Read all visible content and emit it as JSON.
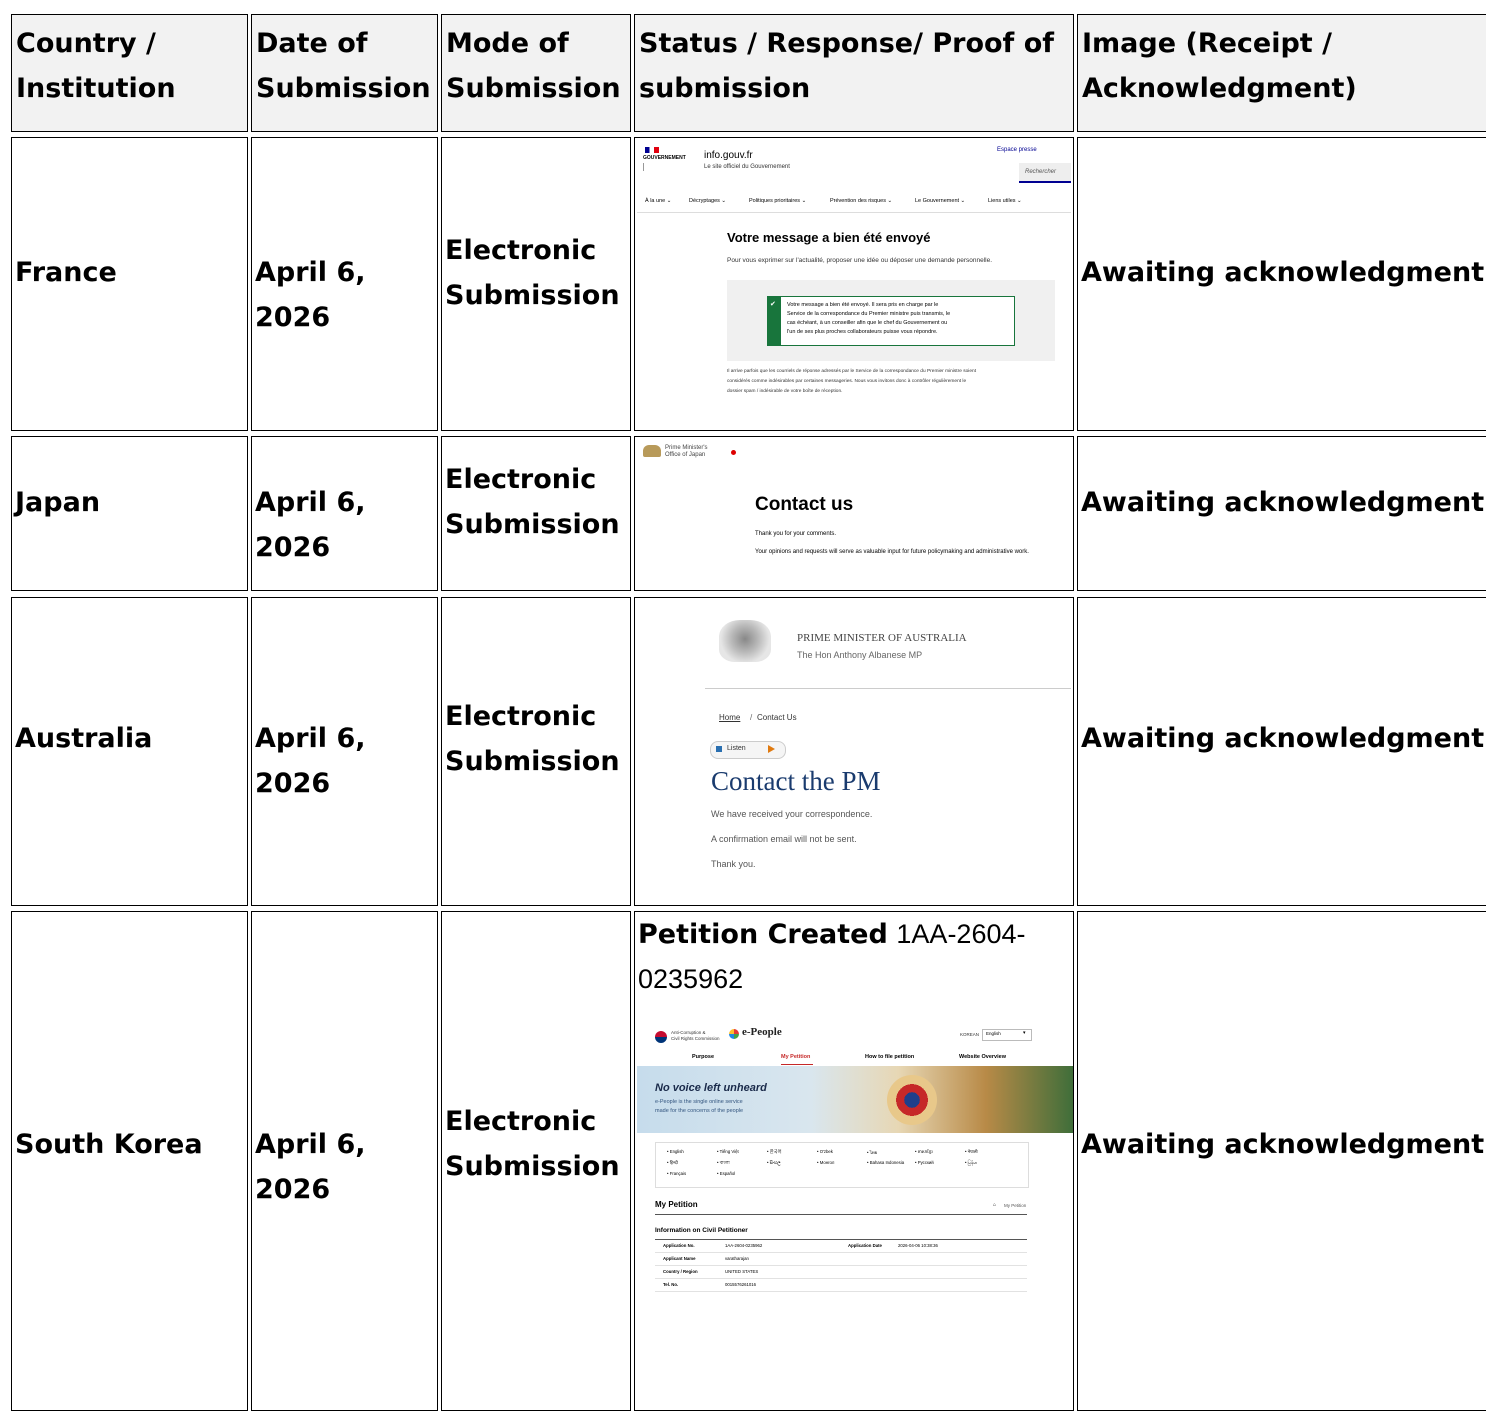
{
  "table": {
    "headers": [
      "Country / Institution",
      "Date of Submission",
      "Mode of Submission",
      "Status / Response/ Proof of submission",
      "Image (Receipt / Acknowledgment)"
    ],
    "rows": [
      {
        "country": "France",
        "date": "April 6, 2026",
        "mode": "Electronic Submission",
        "status": "Awaiting acknowledgment."
      },
      {
        "country": "Japan",
        "date": "April 6, 2026",
        "mode": "Electronic Submission",
        "status": "Awaiting acknowledgment."
      },
      {
        "country": "Australia",
        "date": "April 6, 2026",
        "mode": "Electronic Submission",
        "status": "Awaiting acknowledgment."
      },
      {
        "country": "South Korea",
        "date": "April 6, 2026",
        "mode": "Electronic Submission",
        "status": "Awaiting acknowledgment."
      }
    ]
  },
  "france_shot": {
    "gov": "GOUVERNEMENT",
    "site": "info.gouv.fr",
    "site_sub": "Le site officiel du Gouvernement",
    "press": "Espace presse",
    "search": "Rechercher",
    "nav": [
      "À la une ⌄",
      "Décryptages ⌄",
      "Politiques prioritaires ⌄",
      "Prévention des risques ⌄",
      "Le Gouvernement ⌄",
      "Liens utiles ⌄"
    ],
    "title": "Votre message a bien été envoyé",
    "subtitle": "Pour vous exprimer sur l'actualité, proposer une idée ou déposer une demande personnelle.",
    "box_lines": [
      "Votre message a bien été envoyé. Il sera pris en charge par le",
      "Service de la correspondance du Premier ministre puis transmis, le",
      "cas échéant, à un conseiller afin que le chef du Gouvernement ou",
      "l'un de ses plus proches collaborateurs puisse vous répondre."
    ],
    "note_lines": [
      "Il arrive parfois que les courriels de réponse adressés par le Service de la correspondance du Premier ministre soient",
      "considérés comme indésirables par certaines messageries. Nous vous invitons donc à contrôler régulièrement le",
      "dossier spam / indésirable de votre boîte de réception."
    ]
  },
  "japan_shot": {
    "logo_line1": "Prime Minister's",
    "logo_line2": "Office of Japan",
    "title": "Contact us",
    "line1": "Thank you for your comments.",
    "line2": "Your opinions and requests will serve as valuable input for future policymaking and administrative work."
  },
  "australia_shot": {
    "org": "PRIME MINISTER OF AUSTRALIA",
    "pm": "The Hon Anthony Albanese MP",
    "crumb_home": "Home",
    "crumb_sep": "/",
    "crumb_page": "Contact Us",
    "listen": "Listen",
    "title": "Contact the PM",
    "line1": "We have received your correspondence.",
    "line2": "A confirmation email will not be sent.",
    "line3": "Thank you."
  },
  "korea": {
    "petition_label": "Petition Created",
    "petition_no_1": "1AA-2604-",
    "petition_no_2": "0235962",
    "shot": {
      "acrc1": "Anti-Corruption &",
      "acrc2": "Civil Rights Commission",
      "brand": "e-People",
      "lang_label": "KOREAN",
      "lang_value": "English",
      "nav": [
        "Purpose",
        "My Petition",
        "How to file petition",
        "Website Overview"
      ],
      "banner_title": "No voice left unheard",
      "banner_sub1": "e-People is the single online service",
      "banner_sub2": "made for the concerns of the people",
      "languages": [
        "English",
        "Tiếng Việt",
        "한국어",
        "O'zbek",
        "ไทย",
        "ភាសាខ្មែរ",
        "नेपाली",
        "हिन्दी",
        "বাংলা",
        "සිංහල",
        "Монгол",
        "Bahasa Indonesia",
        "Русский",
        "မြန်မာ",
        "Français",
        "Español"
      ],
      "section": "My Petition",
      "crumb": "My Petition",
      "info_title": "Information on Civil Petitioner",
      "rows": [
        {
          "k": "Application No.",
          "v": "1AA-2604-0235962",
          "k2": "Application Date",
          "v2": "2026-04-06 10:38:36"
        },
        {
          "k": "Applicant Name",
          "v": "varatharajan",
          "k2": "",
          "v2": ""
        },
        {
          "k": "Country / Region",
          "v": "UNITED STATES",
          "k2": "",
          "v2": ""
        },
        {
          "k": "Tel. No.",
          "v": "0015576261016",
          "k2": "",
          "v2": ""
        }
      ]
    }
  }
}
